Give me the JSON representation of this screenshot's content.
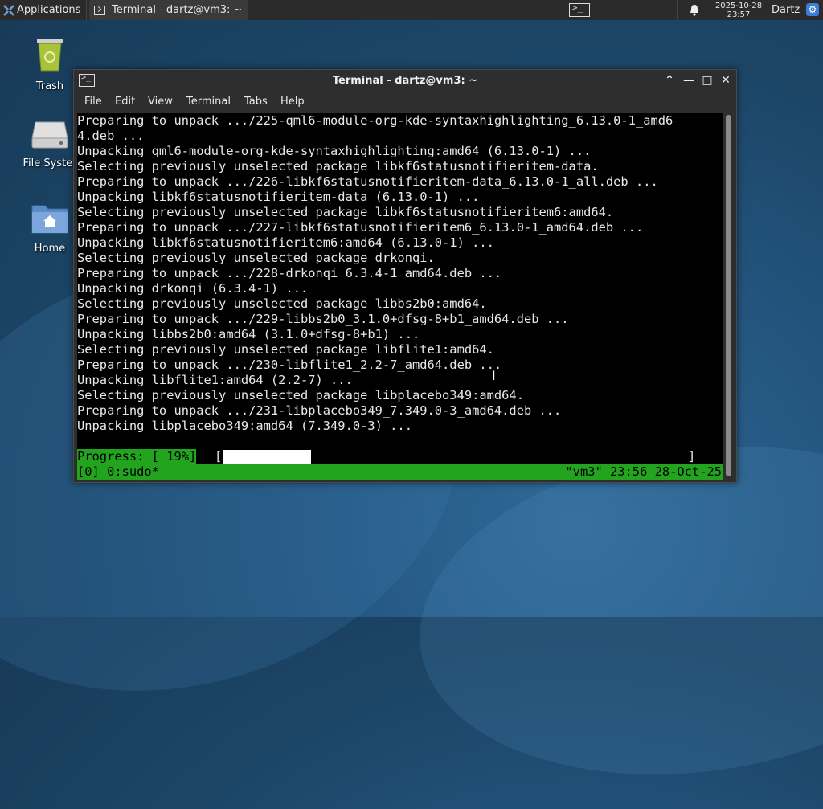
{
  "panel": {
    "applications_label": "Applications",
    "task_label": "Terminal - dartz@vm3: ~",
    "clock_date": "2025-10-28",
    "clock_time": "23:57",
    "user": "Dartz"
  },
  "desktop": {
    "icons": [
      {
        "label": "Trash",
        "icon": "trash-icon"
      },
      {
        "label": "File Syster",
        "icon": "drive-icon"
      },
      {
        "label": "Home",
        "icon": "home-folder-icon"
      }
    ]
  },
  "window": {
    "title": "Terminal - dartz@vm3: ~",
    "menu": [
      "File",
      "Edit",
      "View",
      "Terminal",
      "Tabs",
      "Help"
    ]
  },
  "terminal": {
    "lines": [
      "Preparing to unpack .../225-qml6-module-org-kde-syntaxhighlighting_6.13.0-1_amd6",
      "4.deb ...",
      "Unpacking qml6-module-org-kde-syntaxhighlighting:amd64 (6.13.0-1) ...",
      "Selecting previously unselected package libkf6statusnotifieritem-data.",
      "Preparing to unpack .../226-libkf6statusnotifieritem-data_6.13.0-1_all.deb ...",
      "Unpacking libkf6statusnotifieritem-data (6.13.0-1) ...",
      "Selecting previously unselected package libkf6statusnotifieritem6:amd64.",
      "Preparing to unpack .../227-libkf6statusnotifieritem6_6.13.0-1_amd64.deb ...",
      "Unpacking libkf6statusnotifieritem6:amd64 (6.13.0-1) ...",
      "Selecting previously unselected package drkonqi.",
      "Preparing to unpack .../228-drkonqi_6.3.4-1_amd64.deb ...",
      "Unpacking drkonqi (6.3.4-1) ...",
      "Selecting previously unselected package libbs2b0:amd64.",
      "Preparing to unpack .../229-libbs2b0_3.1.0+dfsg-8+b1_amd64.deb ...",
      "Unpacking libbs2b0:amd64 (3.1.0+dfsg-8+b1) ...",
      "Selecting previously unselected package libflite1:amd64.",
      "Preparing to unpack .../230-libflite1_2.2-7_amd64.deb ...",
      "Unpacking libflite1:amd64 (2.2-7) ...",
      "Selecting previously unselected package libplacebo349:amd64.",
      "Preparing to unpack .../231-libplacebo349_7.349.0-3_amd64.deb ...",
      "Unpacking libplacebo349:amd64 (7.349.0-3) ..."
    ],
    "progress_label": "Progress: [ 19%]",
    "progress_open": "[",
    "progress_close": "]",
    "progress_fraction": 0.19,
    "tmux_left": "[0] 0:sudo*",
    "tmux_right": "\"vm3\" 23:56 28-Oct-25"
  },
  "colors": {
    "tmux_green": "#22a41f",
    "terminal_bg": "#000000"
  }
}
